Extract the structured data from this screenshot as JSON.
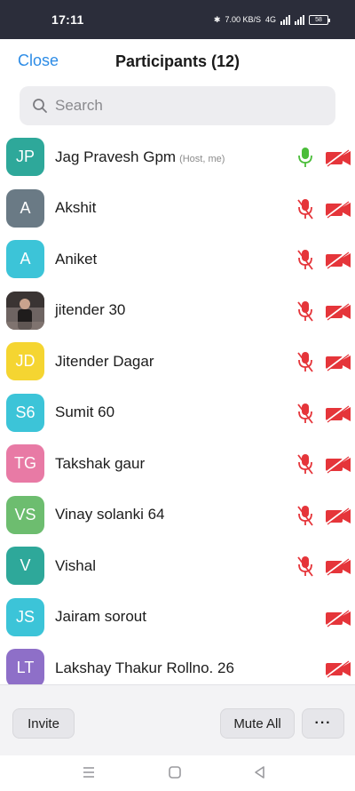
{
  "status_bar": {
    "time": "17:11",
    "speed": "7.00 KB/S",
    "battery": "58",
    "network": "4G"
  },
  "header": {
    "close_label": "Close",
    "title": "Participants (12)"
  },
  "search": {
    "placeholder": "Search"
  },
  "participants": [
    {
      "initials": "JP",
      "name": "Jag Pravesh Gpm",
      "role": "(Host, me)",
      "color": "#2ea89a",
      "mic": "on",
      "video": "off"
    },
    {
      "initials": "A",
      "name": "Akshit",
      "role": "",
      "color": "#6a7a85",
      "mic": "muted",
      "video": "off"
    },
    {
      "initials": "A",
      "name": "Aniket",
      "role": "",
      "color": "#3cc4d8",
      "mic": "muted",
      "video": "off"
    },
    {
      "initials": "",
      "name": "jitender 30",
      "role": "",
      "color": "#4a4342",
      "mic": "muted",
      "video": "off",
      "photo": true
    },
    {
      "initials": "JD",
      "name": "Jitender Dagar",
      "role": "",
      "color": "#f5d531",
      "mic": "muted",
      "video": "off"
    },
    {
      "initials": "S6",
      "name": "Sumit 60",
      "role": "",
      "color": "#3cc4d8",
      "mic": "muted",
      "video": "off"
    },
    {
      "initials": "TG",
      "name": "Takshak gaur",
      "role": "",
      "color": "#e87aa5",
      "mic": "muted",
      "video": "off"
    },
    {
      "initials": "VS",
      "name": "Vinay solanki 64",
      "role": "",
      "color": "#6dbd6f",
      "mic": "muted",
      "video": "off"
    },
    {
      "initials": "V",
      "name": "Vishal",
      "role": "",
      "color": "#2ea89a",
      "mic": "muted",
      "video": "off"
    },
    {
      "initials": "JS",
      "name": "Jairam sorout",
      "role": "",
      "color": "#3cc4d8",
      "mic": "none",
      "video": "off"
    },
    {
      "initials": "LT",
      "name": "Lakshay Thakur Rollno. 26",
      "role": "",
      "color": "#8e6fc8",
      "mic": "none",
      "video": "off"
    }
  ],
  "footer": {
    "invite_label": "Invite",
    "mute_all_label": "Mute All",
    "more_label": "···"
  },
  "colors": {
    "accent": "#2d8ce6",
    "muted_red": "#e5353a",
    "mic_on_green": "#4bbd3a"
  }
}
